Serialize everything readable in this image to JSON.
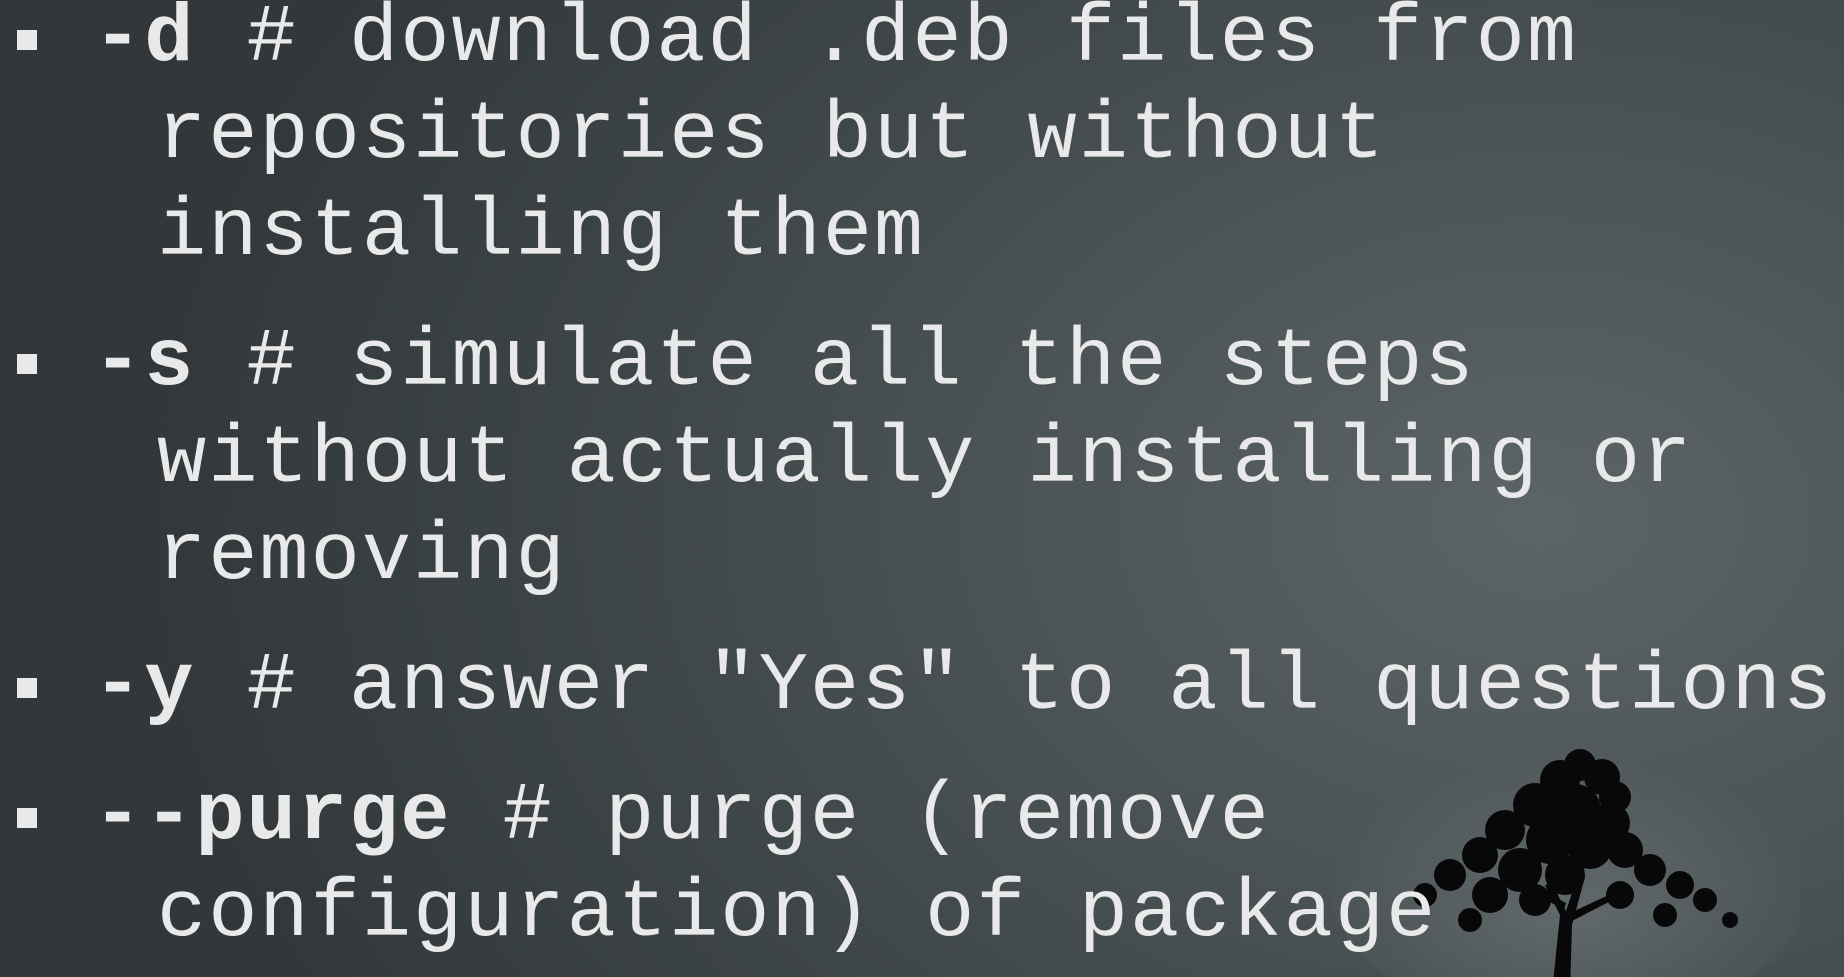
{
  "slide": {
    "background_color": "#3c4347",
    "text_color": "#e9e9e9",
    "bullets": [
      {
        "flag": "-d",
        "lines": [
          " # download .deb files from",
          "repositories but without",
          "installing them"
        ]
      },
      {
        "flag": "-s",
        "lines": [
          " # simulate all the steps",
          "without actually installing or",
          "removing"
        ]
      },
      {
        "flag": "-y",
        "lines": [
          " # answer \"Yes\" to all questions"
        ]
      },
      {
        "flag": "--purge",
        "lines": [
          " # purge (remove",
          "configuration) of package"
        ]
      }
    ],
    "decoration": {
      "icon": "tree-silhouette-icon"
    }
  }
}
